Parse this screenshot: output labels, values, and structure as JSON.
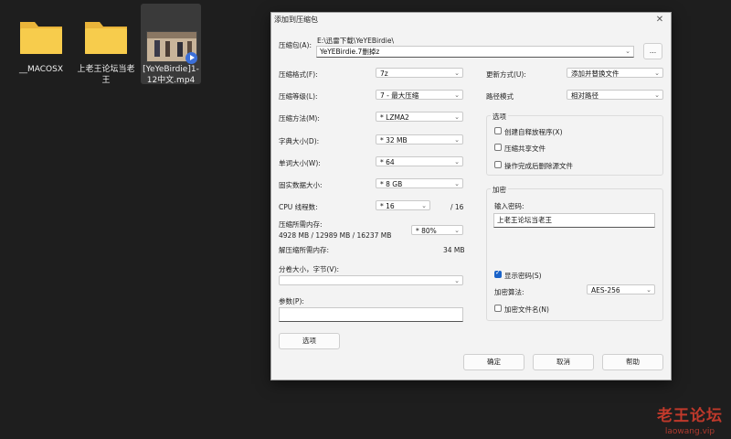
{
  "desktop": {
    "items": [
      {
        "label": "__MACOSX",
        "type": "folder"
      },
      {
        "label": "上老王论坛当老王",
        "type": "folder"
      },
      {
        "label": "[YeYeBirdie]1-12中文.mp4",
        "type": "video"
      }
    ]
  },
  "dialog": {
    "title": "添加到压缩包",
    "close_icon": "close-icon",
    "archive": {
      "label": "压缩包(A):",
      "path": "E:\\迅雷下载\\YeYEBirdie\\",
      "value": "YeYEBirdie.7删掉z",
      "browse": "..."
    },
    "format": {
      "label": "压缩格式(F):",
      "value": "7z"
    },
    "level": {
      "label": "压缩等级(L):",
      "value": "7 - 最大压缩"
    },
    "method": {
      "label": "压缩方法(M):",
      "value": "* LZMA2"
    },
    "dict": {
      "label": "字典大小(D):",
      "value": "* 32 MB"
    },
    "word": {
      "label": "单词大小(W):",
      "value": "* 64"
    },
    "solid": {
      "label": "固实数据大小:",
      "value": "* 8 GB"
    },
    "threads": {
      "label": "CPU 线程数:",
      "value": "* 16",
      "total": "/ 16"
    },
    "memory": {
      "label": "压缩所需内存:",
      "value": "4928 MB / 12989 MB / 16237 MB",
      "percent": "* 80%"
    },
    "decomp": {
      "label": "解压缩所需内存:",
      "value": "34 MB"
    },
    "split": {
      "label": "分卷大小，字节(V):",
      "value": ""
    },
    "params": {
      "label": "参数(P):",
      "value": ""
    },
    "options_button": "选项",
    "update": {
      "label": "更新方式(U):",
      "value": "添加并替换文件"
    },
    "pathmode": {
      "label": "路径模式",
      "value": "相对路径"
    },
    "options_group": {
      "title": "选项",
      "items": [
        {
          "label": "创建自释放程序(X)",
          "checked": false
        },
        {
          "label": "压缩共享文件",
          "checked": false
        },
        {
          "label": "操作完成后删除源文件",
          "checked": false
        }
      ]
    },
    "encrypt_group": {
      "title": "加密",
      "password_label": "输入密码:",
      "password_value": "上老王论坛当老王",
      "show_password": {
        "label": "显示密码(S)",
        "checked": true
      },
      "algo_label": "加密算法:",
      "algo_value": "AES-256",
      "encrypt_names": {
        "label": "加密文件名(N)",
        "checked": false
      }
    },
    "buttons": {
      "ok": "确定",
      "cancel": "取消",
      "help": "帮助"
    }
  },
  "watermark": {
    "main": "老王论坛",
    "sub": "laowang.vip"
  },
  "colors": {
    "accent": "#1a63c9",
    "folder": "#f5c542",
    "watermark": "#c0392b"
  }
}
